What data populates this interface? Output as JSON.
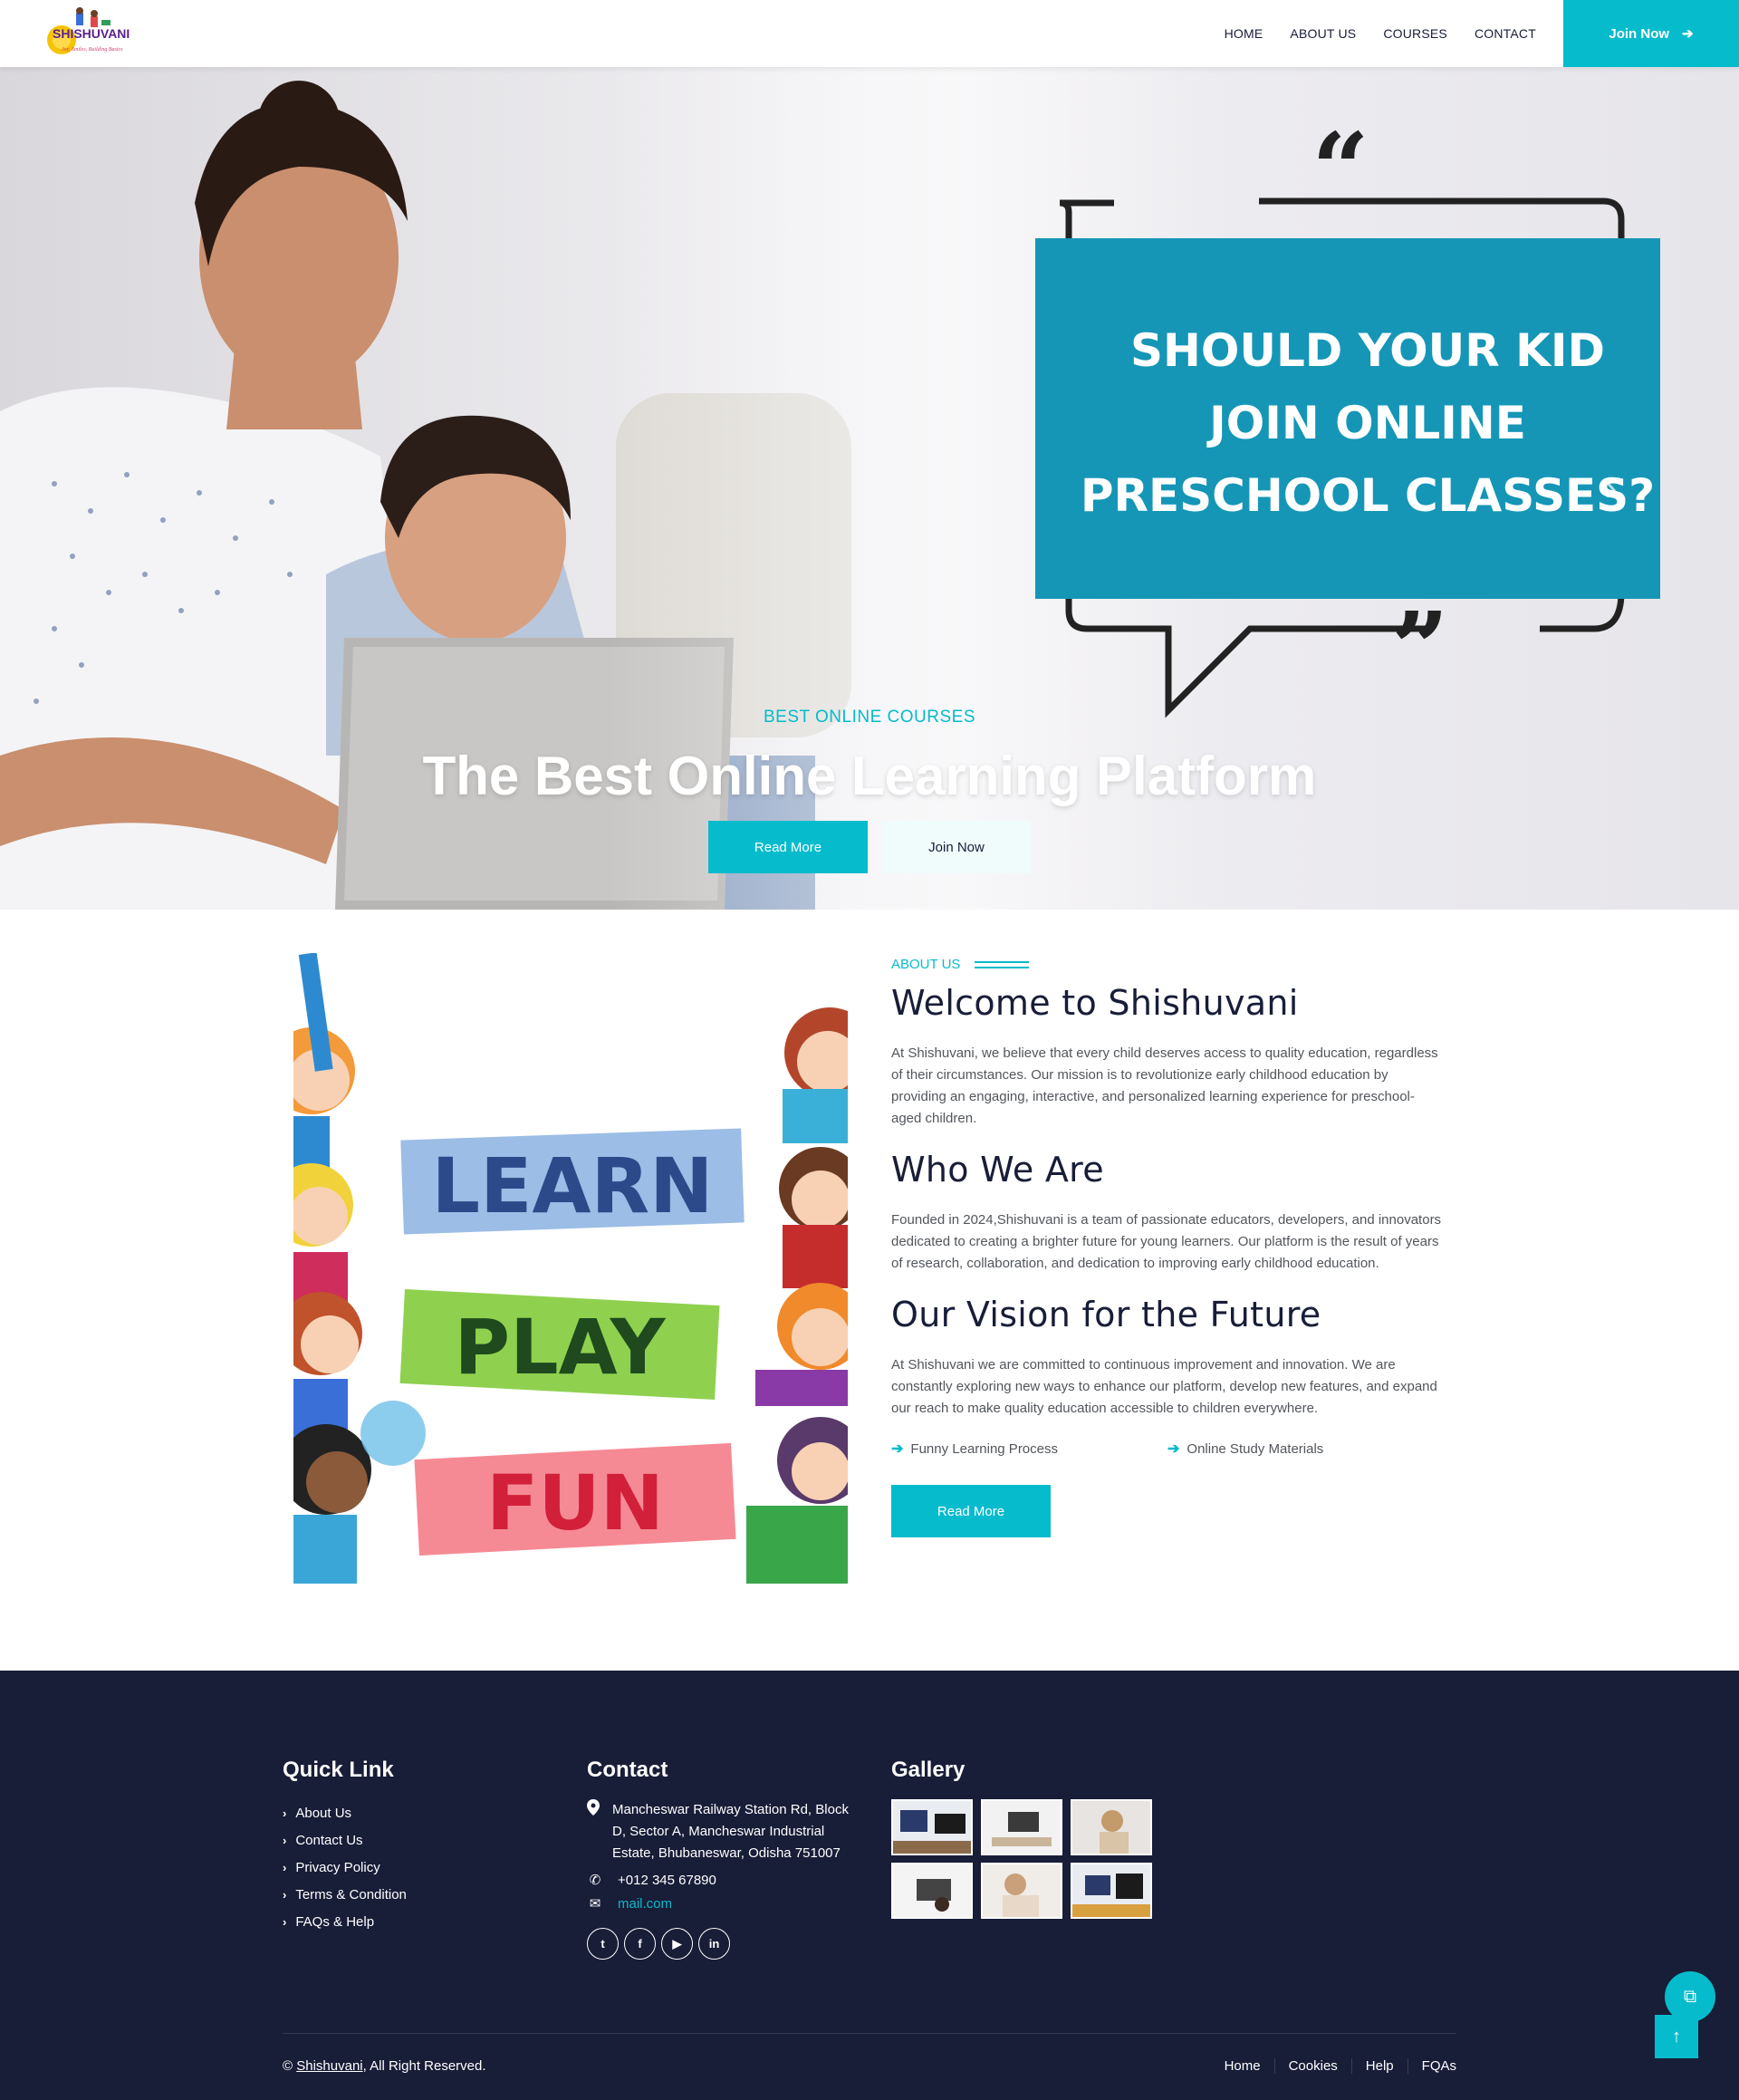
{
  "brand": {
    "name": "SHISHUVANI",
    "tagline": "Joy, Smiles, Building Basics"
  },
  "nav": {
    "items": [
      "HOME",
      "ABOUT US",
      "COURSES",
      "CONTACT"
    ],
    "join_label": "Join Now"
  },
  "hero": {
    "image_text": {
      "line1": "SHOULD YOUR KID",
      "line2": "JOIN ONLINE",
      "line3": "PRESCHOOL CLASSES?"
    },
    "subtitle": "BEST ONLINE COURSES",
    "title": "The Best Online Learning Platform",
    "primary_btn": "Read More",
    "secondary_btn": "Join Now"
  },
  "about": {
    "image_words": [
      "LEARN",
      "PLAY",
      "FUN"
    ],
    "label": "ABOUT US",
    "heading": "Welcome to Shishuvani",
    "intro": "At Shishuvani, we believe that every child deserves access to quality education, regardless of their circumstances. Our mission is to revolutionize early childhood education by providing an engaging, interactive, and personalized learning experience for preschool-aged children.",
    "who_heading": "Who We Are",
    "who_text": "Founded in 2024,Shishuvani is a team of passionate educators, developers, and innovators dedicated to creating a brighter future for young learners. Our platform is the result of years of research, collaboration, and dedication to improving early childhood education.",
    "vision_heading": "Our Vision for the Future",
    "vision_text": "At Shishuvani we are committed to continuous improvement and innovation. We are constantly exploring new ways to enhance our platform, develop new features, and expand our reach to make quality education accessible to children everywhere.",
    "features": [
      "Funny Learning Process",
      "Online Study Materials"
    ],
    "button": "Read More"
  },
  "footer": {
    "quick_title": "Quick Link",
    "quick_links": [
      "About Us",
      "Contact Us",
      "Privacy Policy",
      "Terms & Condition",
      "FAQs & Help"
    ],
    "contact_title": "Contact",
    "address": "Mancheswar Railway Station Rd, Block D, Sector A, Mancheswar Industrial Estate, Bhubaneswar, Odisha 751007",
    "phone": "+012 345 67890",
    "email": "mail.com",
    "gallery_title": "Gallery",
    "copyright_prefix": "©",
    "copyright_brand": "Shishuvani",
    "copyright_suffix": ", All Right Reserved.",
    "bottom_links": [
      "Home",
      "Cookies",
      "Help",
      "FQAs"
    ]
  },
  "colors": {
    "accent": "#06bbcc",
    "dark": "#181d38",
    "text": "#52565b"
  }
}
